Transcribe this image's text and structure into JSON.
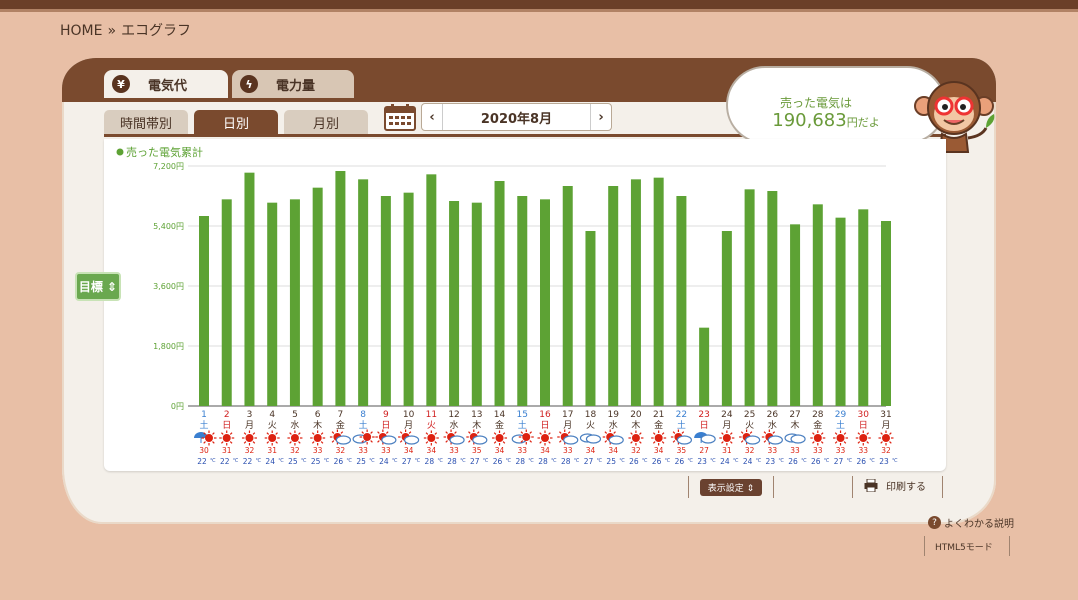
{
  "breadcrumb": {
    "home": "HOME",
    "sep": "»",
    "current": "エコグラフ"
  },
  "tabs": [
    {
      "label": "電気代",
      "icon": "yen-icon",
      "icon_glyph": "¥"
    },
    {
      "label": "電力量",
      "icon": "bolt-icon",
      "icon_glyph": "ϟ"
    }
  ],
  "subtabs": [
    "時間帯別",
    "日別",
    "月別"
  ],
  "date_nav": {
    "prev": "‹",
    "label": "2020年8月",
    "next": "›"
  },
  "summary": {
    "line1": "売った電気は",
    "amount": "190,683",
    "suffix": "円だよ"
  },
  "goal_button": "目標 ⇕",
  "footer": {
    "display_settings": "表示設定 ⇕",
    "print": "印刷する",
    "help_q": "?",
    "help": "よくわかる説明",
    "html5": "HTML5モード"
  },
  "colors": {
    "bar": "#5da234",
    "brown": "#7a4a2e",
    "sat": "#3a7fd0",
    "sun_holiday": "#d02020",
    "text": "#4a3426"
  },
  "chart_data": {
    "type": "bar",
    "title": "",
    "legend": "売った電気累計",
    "ylim": [
      0,
      7200
    ],
    "ytick_labels": [
      "0円",
      "1,800円",
      "3,600円",
      "5,400円",
      "7,200円"
    ],
    "yticks": [
      0,
      1800,
      3600,
      5400,
      7200
    ],
    "days": [
      "1",
      "2",
      "3",
      "4",
      "5",
      "6",
      "7",
      "8",
      "9",
      "10",
      "11",
      "12",
      "13",
      "14",
      "15",
      "16",
      "17",
      "18",
      "19",
      "20",
      "21",
      "22",
      "23",
      "24",
      "25",
      "26",
      "27",
      "28",
      "29",
      "30",
      "31"
    ],
    "weekdays": [
      "土",
      "日",
      "月",
      "火",
      "水",
      "木",
      "金",
      "土",
      "日",
      "月",
      "火",
      "水",
      "木",
      "金",
      "土",
      "日",
      "月",
      "火",
      "水",
      "木",
      "金",
      "土",
      "日",
      "月",
      "火",
      "水",
      "木",
      "金",
      "土",
      "日",
      "月"
    ],
    "red_days": [
      "2",
      "9",
      "11",
      "16",
      "23",
      "30"
    ],
    "blue_days": [
      "1",
      "8",
      "15",
      "22",
      "29"
    ],
    "values": [
      5700,
      6200,
      7000,
      6100,
      6200,
      6550,
      7050,
      6800,
      6300,
      6400,
      6950,
      6150,
      6100,
      6750,
      6300,
      6200,
      6600,
      5250,
      6600,
      6800,
      6850,
      6300,
      2350,
      5250,
      6500,
      6450,
      5450,
      6050,
      5650,
      5900,
      5550
    ],
    "weather": [
      "umbrella-sun",
      "sun",
      "sun",
      "sun",
      "sun",
      "sun",
      "sun-cloud",
      "cloud-sun",
      "sun-cloud",
      "sun-cloud",
      "sun",
      "sun-cloud",
      "sun-cloud",
      "sun",
      "cloud-sun",
      "sun",
      "sun-cloud",
      "cloud",
      "sun-cloud",
      "sun",
      "sun",
      "sun-cloud",
      "umbrella-cloud",
      "sun",
      "sun-cloud",
      "sun-cloud",
      "cloud",
      "sun",
      "sun",
      "sun",
      "sun"
    ],
    "temp_high": [
      "30",
      "31",
      "32",
      "31",
      "32",
      "33",
      "32",
      "33",
      "33",
      "34",
      "34",
      "33",
      "35",
      "34",
      "33",
      "34",
      "33",
      "34",
      "34",
      "32",
      "34",
      "35",
      "27",
      "31",
      "32",
      "33",
      "33",
      "33",
      "33",
      "33",
      "32"
    ],
    "temp_low": [
      "22",
      "22",
      "22",
      "24",
      "25",
      "25",
      "26",
      "25",
      "24",
      "27",
      "28",
      "28",
      "27",
      "26",
      "28",
      "28",
      "28",
      "27",
      "25",
      "26",
      "26",
      "26",
      "23",
      "24",
      "24",
      "23",
      "26",
      "26",
      "27",
      "26",
      "23"
    ],
    "deg": "℃"
  }
}
